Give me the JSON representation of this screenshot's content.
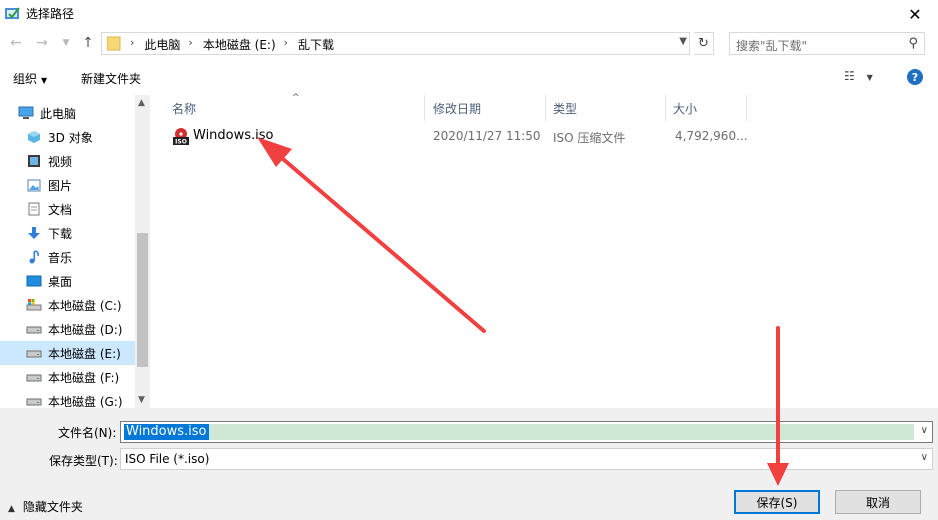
{
  "window": {
    "title": "选择路径",
    "close_label": "✕"
  },
  "address": {
    "crumbs": [
      "此电脑",
      "本地磁盘 (E:)",
      "乱下载"
    ],
    "search_placeholder": "搜索\"乱下载\""
  },
  "toolbar": {
    "organize": "组织",
    "new_folder": "新建文件夹",
    "help": "?"
  },
  "nav": {
    "items": [
      {
        "label": "此电脑",
        "icon": "computer-icon"
      },
      {
        "label": "3D 对象",
        "icon": "cube-3d-icon"
      },
      {
        "label": "视频",
        "icon": "video-icon"
      },
      {
        "label": "图片",
        "icon": "picture-icon"
      },
      {
        "label": "文档",
        "icon": "document-icon"
      },
      {
        "label": "下载",
        "icon": "download-arrow-icon"
      },
      {
        "label": "音乐",
        "icon": "music-note-icon"
      },
      {
        "label": "桌面",
        "icon": "desktop-icon"
      },
      {
        "label": "本地磁盘 (C:)",
        "icon": "system-drive-icon"
      },
      {
        "label": "本地磁盘 (D:)",
        "icon": "drive-icon"
      },
      {
        "label": "本地磁盘 (E:)",
        "icon": "drive-icon",
        "selected": true
      },
      {
        "label": "本地磁盘 (F:)",
        "icon": "drive-icon"
      },
      {
        "label": "本地磁盘 (G:)",
        "icon": "drive-icon"
      }
    ]
  },
  "columns": {
    "name": "名称",
    "modified": "修改日期",
    "type": "类型",
    "size": "大小"
  },
  "files": [
    {
      "name": "Windows.iso",
      "modified": "2020/11/27 11:50",
      "type": "ISO 压缩文件",
      "size": "4,792,960...",
      "icon": "iso-file-icon"
    }
  ],
  "bottom": {
    "filename_label": "文件名(N):",
    "filename_value": "Windows.iso",
    "filetype_label": "保存类型(T):",
    "filetype_value": "ISO File (*.iso)",
    "hide_folders": "隐藏文件夹",
    "save": "保存(S)",
    "cancel": "取消"
  },
  "colors": {
    "selection": "#cce8ff",
    "accent": "#0078d7",
    "annotation": "#f04040"
  }
}
